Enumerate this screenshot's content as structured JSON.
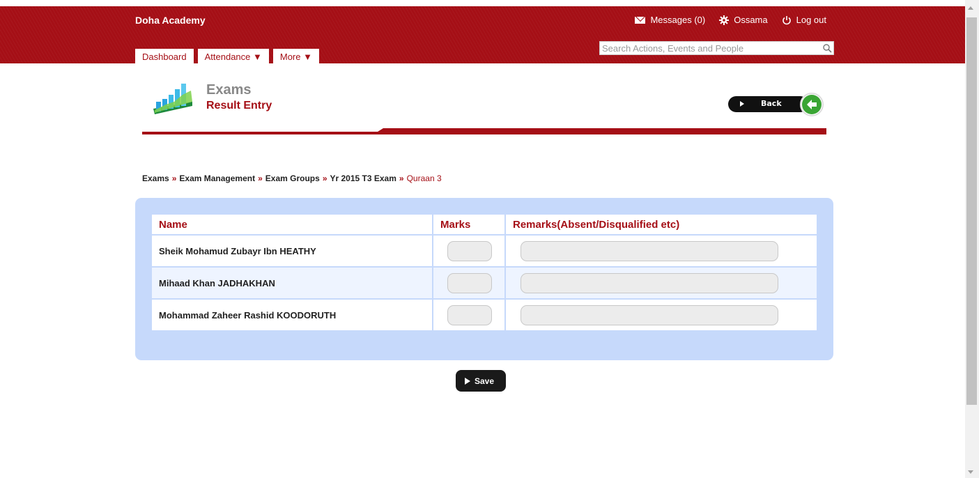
{
  "header": {
    "brand": "Doha Academy",
    "messages": "Messages (0)",
    "user": "Ossama",
    "logout": "Log out",
    "search_placeholder": "Search Actions, Events and People"
  },
  "tabs": [
    {
      "label": "Dashboard"
    },
    {
      "label": "Attendance ▼"
    },
    {
      "label": "More ▼"
    }
  ],
  "page": {
    "title": "Exams",
    "subtitle": "Result Entry",
    "back_label": "Back"
  },
  "breadcrumb": {
    "items": [
      "Exams",
      "Exam Management",
      "Exam Groups",
      "Yr 2015 T3 Exam"
    ],
    "separator": "»",
    "current": "Quraan 3"
  },
  "table": {
    "headers": [
      "Name",
      "Marks",
      "Remarks(Absent/Disqualified etc)"
    ],
    "rows": [
      {
        "name": "Sheik Mohamud Zubayr Ibn HEATHY",
        "marks": "",
        "remarks": ""
      },
      {
        "name": "Mihaad Khan JADHAKHAN",
        "marks": "",
        "remarks": ""
      },
      {
        "name": "Mohammad Zaheer Rashid KOODORUTH",
        "marks": "",
        "remarks": ""
      }
    ]
  },
  "save_label": "Save",
  "colors": {
    "brand_red": "#a50f16",
    "panel_blue": "#c6d9fb",
    "button_dark": "#1a1a1a",
    "back_green": "#3aa534"
  }
}
